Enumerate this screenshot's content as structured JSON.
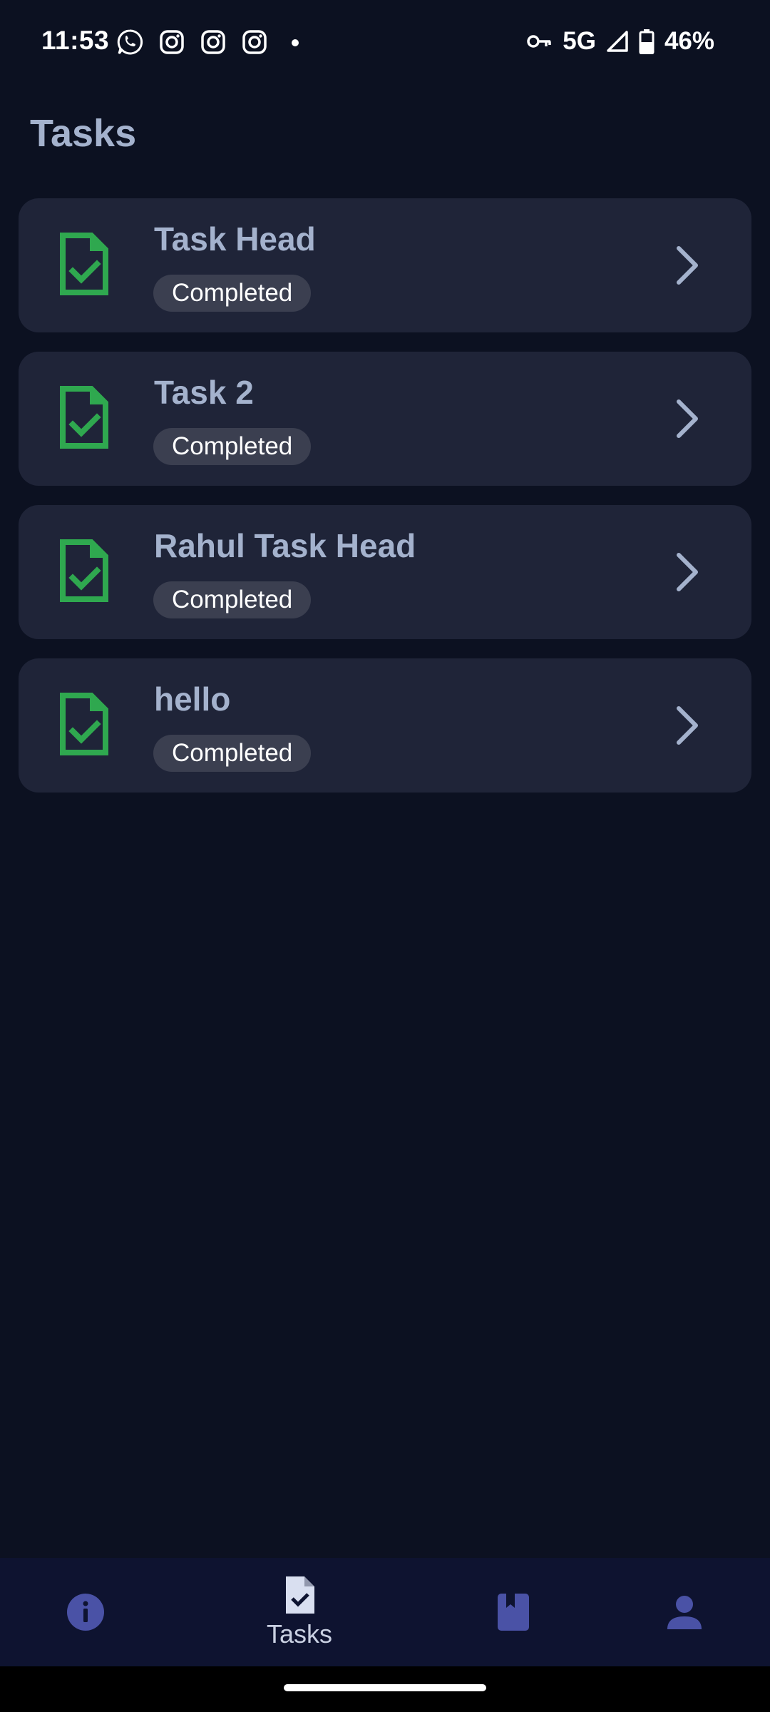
{
  "status_bar": {
    "time": "11:53",
    "notification_icons": [
      "whatsapp-icon",
      "instagram-icon",
      "instagram-icon",
      "instagram-icon",
      "dot-icon"
    ],
    "network": "5G",
    "battery": "46%"
  },
  "header": {
    "title": "Tasks"
  },
  "tasks": [
    {
      "name": "Task Head",
      "status": "Completed"
    },
    {
      "name": "Task 2",
      "status": "Completed"
    },
    {
      "name": "Rahul Task Head",
      "status": "Completed"
    },
    {
      "name": "hello",
      "status": "Completed"
    }
  ],
  "bottom_nav": {
    "items": [
      {
        "icon": "info-icon",
        "label": ""
      },
      {
        "icon": "task-doc-icon",
        "label": "Tasks",
        "active": true
      },
      {
        "icon": "book-icon",
        "label": ""
      },
      {
        "icon": "person-icon",
        "label": ""
      }
    ]
  },
  "colors": {
    "background": "#0c1121",
    "card": "#1f2438",
    "title_text": "#a4b2cd",
    "badge": "#3b3f50",
    "success_green": "#2fa84f",
    "nav_background": "#0e1330",
    "nav_icon_inactive": "#4a52a6"
  }
}
